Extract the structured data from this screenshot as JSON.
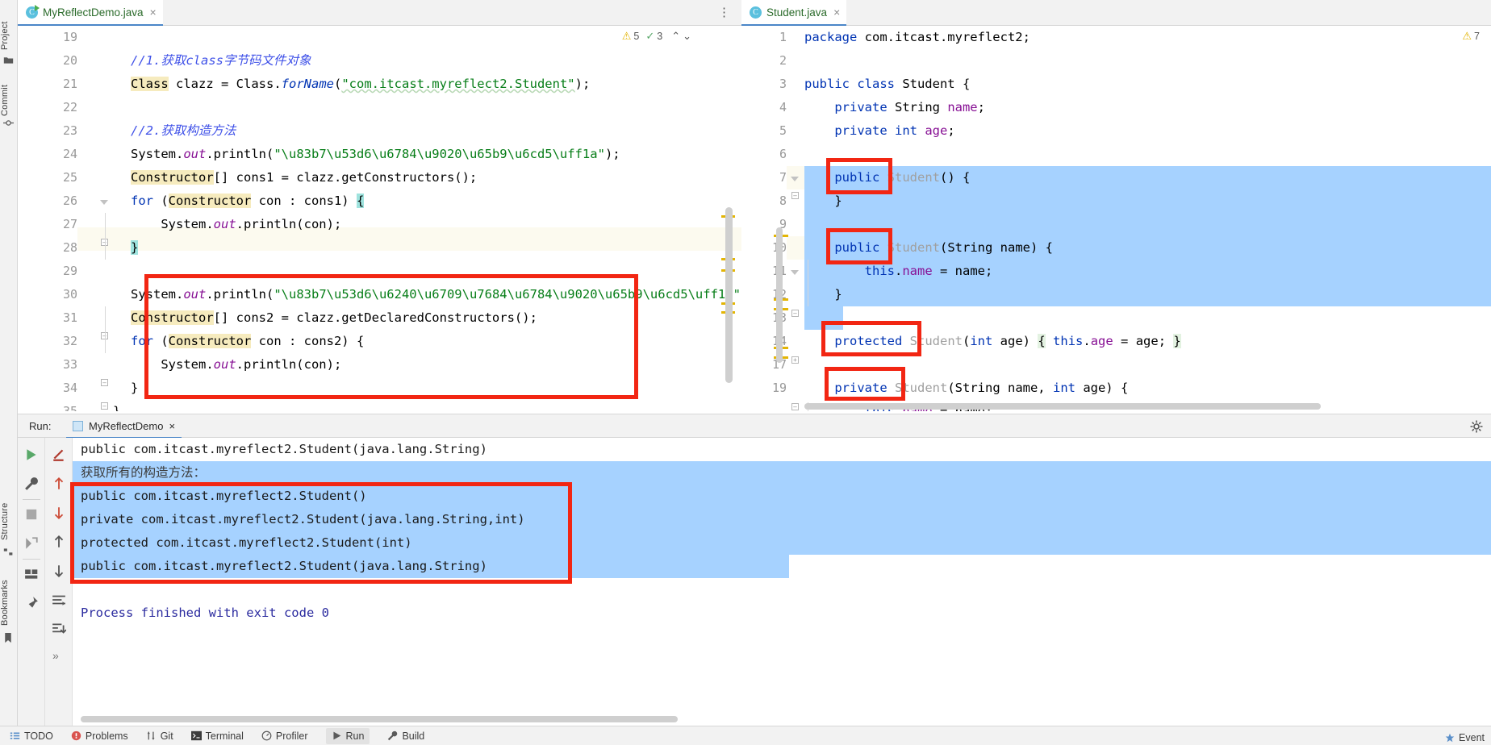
{
  "rail": {
    "items": [
      {
        "label": "Project",
        "icon": "folder-icon"
      },
      {
        "label": "Commit",
        "icon": "commit-icon"
      },
      {
        "label": "Structure",
        "icon": "structure-icon"
      },
      {
        "label": "Bookmarks",
        "icon": "bookmark-icon"
      }
    ]
  },
  "left_editor": {
    "tab": {
      "label": "MyReflectDemo.java",
      "close": "×",
      "icon": "java-class-run-icon"
    },
    "inspections": {
      "warn_count": "5",
      "ok_count": "3",
      "up": "⌃",
      "down": "⌄"
    },
    "overflow_menu": "⋮",
    "lines": [
      {
        "n": "19",
        "code": ""
      },
      {
        "n": "20",
        "code": "//1.获取class字节码文件对象"
      },
      {
        "n": "21",
        "code": "Class clazz = Class.forName(\"com.itcast.myreflect2.Student\");"
      },
      {
        "n": "22",
        "code": ""
      },
      {
        "n": "23",
        "code": "//2.获取构造方法"
      },
      {
        "n": "24",
        "code": "System.out.println(\"获取构造方法：\");"
      },
      {
        "n": "25",
        "code": "Constructor[] cons1 = clazz.getConstructors();"
      },
      {
        "n": "26",
        "code": "for (Constructor con : cons1) {"
      },
      {
        "n": "27",
        "code": "    System.out.println(con);"
      },
      {
        "n": "28",
        "code": "}"
      },
      {
        "n": "29",
        "code": ""
      },
      {
        "n": "30",
        "code": "System.out.println(\"获取所有的构造方法：\");"
      },
      {
        "n": "31",
        "code": "Constructor[] cons2 = clazz.getDeclaredConstructors();"
      },
      {
        "n": "32",
        "code": "for (Constructor con : cons2) {"
      },
      {
        "n": "33",
        "code": "    System.out.println(con);"
      },
      {
        "n": "34",
        "code": "}"
      },
      {
        "n": "35",
        "code": "}"
      }
    ]
  },
  "right_editor": {
    "tab": {
      "label": "Student.java",
      "close": "×",
      "icon": "java-class-icon"
    },
    "inspections": {
      "warn_count": "7"
    },
    "lines": [
      {
        "n": "1",
        "code": "package com.itcast.myreflect2;"
      },
      {
        "n": "2",
        "code": ""
      },
      {
        "n": "3",
        "code": "public class Student {"
      },
      {
        "n": "4",
        "code": "    private String name;"
      },
      {
        "n": "5",
        "code": "    private int age;"
      },
      {
        "n": "6",
        "code": ""
      },
      {
        "n": "7",
        "code": "    public Student() {"
      },
      {
        "n": "8",
        "code": "    }"
      },
      {
        "n": "9",
        "code": ""
      },
      {
        "n": "10",
        "code": "    public Student(String name) {"
      },
      {
        "n": "11",
        "code": "        this.name = name;"
      },
      {
        "n": "12",
        "code": "    }"
      },
      {
        "n": "13",
        "code": ""
      },
      {
        "n": "14",
        "code": "    protected Student(int age) { this.age = age; }"
      },
      {
        "n": "17",
        "code": "    private Student(String name, int age) {"
      },
      {
        "n": "19",
        "code": "        this.name = name;"
      }
    ]
  },
  "run_panel": {
    "run_label": "Run:",
    "tab_label": "MyReflectDemo",
    "tab_close": "×",
    "toolbar_icons": [
      "rerun-icon",
      "wrench-icon",
      "stop-icon",
      "rerun-failed-icon",
      "layout-icon",
      "pin-icon"
    ],
    "toolbar2_icons": [
      "soft-wrap-icon",
      "up-arrow-icon",
      "down-arrow-icon",
      "prev-occurrence-icon",
      "next-occurrence-icon",
      "print-icon",
      "scroll-to-end-icon",
      "more-icon"
    ],
    "more_label": "»",
    "console_lines": [
      {
        "text": "public com.itcast.myreflect2.Student(java.lang.String)",
        "selected": false
      },
      {
        "text": "获取所有的构造方法：",
        "selected": true
      },
      {
        "text": "public com.itcast.myreflect2.Student()",
        "selected": true
      },
      {
        "text": "private com.itcast.myreflect2.Student(java.lang.String,int)",
        "selected": true
      },
      {
        "text": "protected com.itcast.myreflect2.Student(int)",
        "selected": true
      },
      {
        "text": "public com.itcast.myreflect2.Student(java.lang.String)",
        "selected": true
      },
      {
        "text": "",
        "selected": false
      },
      {
        "text": "Process finished with exit code 0",
        "selected": false
      }
    ]
  },
  "status_bar": {
    "items": [
      {
        "label": "TODO",
        "icon": "todo-icon",
        "active": false
      },
      {
        "label": "Problems",
        "icon": "problems-icon",
        "active": false
      },
      {
        "label": "Git",
        "icon": "git-icon",
        "active": false
      },
      {
        "label": "Terminal",
        "icon": "terminal-icon",
        "active": false
      },
      {
        "label": "Profiler",
        "icon": "profiler-icon",
        "active": false
      },
      {
        "label": "Run",
        "icon": "run-icon",
        "active": true
      },
      {
        "label": "Build",
        "icon": "build-icon",
        "active": false
      }
    ],
    "right_label": "Event",
    "settings_icon": "gear-icon"
  },
  "colors": {
    "annotation_red": "#f22613",
    "selection_blue": "#a6d2ff",
    "keyword_blue": "#0033b3",
    "string_green": "#067d17",
    "comment_blue": "#3f51e8",
    "field_purple": "#871094",
    "identifier_highlight": "#f6ebbe",
    "brace_match": "#9fe3de",
    "caret_line": "#fcfaef"
  }
}
